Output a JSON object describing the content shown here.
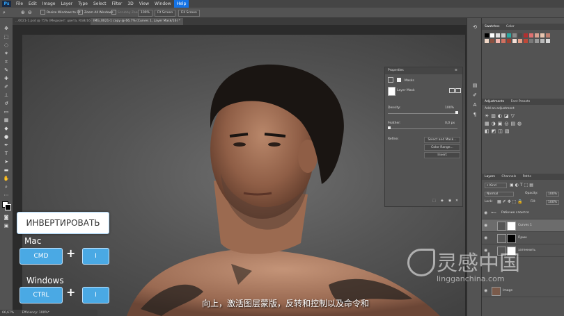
{
  "app": {
    "logo": "Ps"
  },
  "menu": [
    "File",
    "Edit",
    "Image",
    "Layer",
    "Type",
    "Select",
    "Filter",
    "3D",
    "View",
    "Window",
    "Help"
  ],
  "menu_active": "Help",
  "options": {
    "resize_windows": "Resize Windows to Fit",
    "zoom_all": "Zoom All Windows",
    "scrubby": "Scrubby Zoom",
    "zoom_pct": "100%",
    "fit_screen": "Fit Screen",
    "fill_screen": "Fill Screen"
  },
  "tabs": [
    "...0021-1.psd @ 75% (Медиант: цвета, RGB/16) *",
    "IMG_0021-1 copy @ 66,7% (Curves 1, Layer Mask/16) *"
  ],
  "properties": {
    "title": "Properties",
    "section": "Masks",
    "mask_label": "Layer Mask",
    "density_label": "Density:",
    "density_value": "100%",
    "feather_label": "Feather:",
    "feather_value": "0,0 px",
    "refine_label": "Refine:",
    "select_mask": "Select and Mask...",
    "color_range": "Color Range...",
    "invert": "Invert"
  },
  "swatches_panel": {
    "tabs": [
      "Swatches",
      "Color"
    ]
  },
  "swatch_colors": [
    "#000000",
    "#ffffff",
    "#e0e0e0",
    "#c8c8c8",
    "#2aa8a0",
    "#888888",
    "#4a4a4a",
    "#b03030",
    "#e07070",
    "#d9a090",
    "#e9c6b0",
    "#c08070",
    "#f0d8c8",
    "#8a5040",
    "#f6b8b0",
    "#d07060",
    "#a04030",
    "#f4e0d8",
    "#e4a088",
    "#c04838",
    "#7a7a7a",
    "#9a9a9a",
    "#bababa",
    "#d8d8d8"
  ],
  "adjustments_panel": {
    "tabs": [
      "Adjustments",
      "Font Presets"
    ],
    "add_label": "Add an adjustment"
  },
  "layers_panel": {
    "tabs": [
      "Layers",
      "Channels",
      "Paths"
    ],
    "kind": "Kind",
    "blend_mode": "Normal",
    "opacity_label": "Opacity:",
    "opacity_value": "100%",
    "lock_label": "Lock:",
    "fill_label": "Fill:",
    "fill_value": "100%",
    "layers": [
      {
        "name": "Рабочие слоится",
        "type": "group"
      },
      {
        "name": "Curves 1",
        "type": "adjustment"
      },
      {
        "name": "Прим",
        "type": "adjustment"
      },
      {
        "name": "затемнить",
        "type": "adjustment"
      },
      {
        "name": "Image",
        "type": "pixel"
      }
    ]
  },
  "overlay": {
    "title": "ИНВЕРТИРОВАТЬ",
    "mac_label": "Mac",
    "mac_key1": "CMD",
    "mac_key2": "I",
    "win_label": "Windows",
    "win_key1": "CTRL",
    "win_key2": "I",
    "plus": "+"
  },
  "subtitle": "向上，激活图层蒙版，反转和控制以及命令和",
  "watermark": {
    "cn": "灵感中国",
    "url": "lingganchina.com"
  },
  "status": {
    "zoom": "66,67%",
    "info": "Efficiency: 100%*"
  }
}
